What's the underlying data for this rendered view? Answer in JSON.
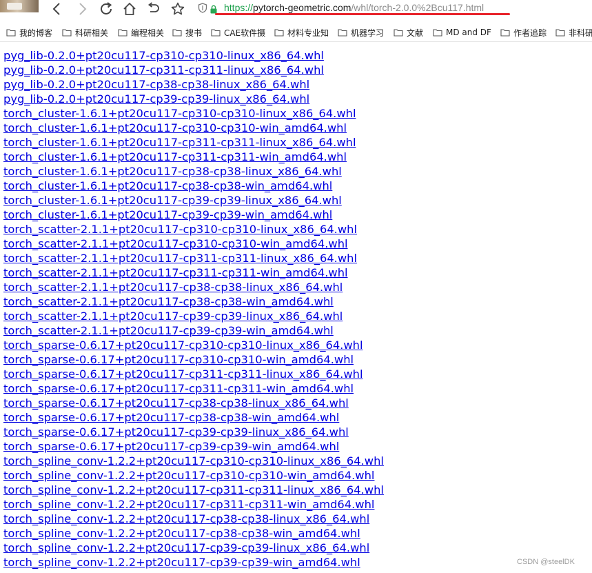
{
  "browser": {
    "url": {
      "scheme": "https://",
      "host": "pytorch-geometric.com",
      "path": "/whl/torch-2.0.0%2Bcu117.html"
    },
    "nav_icons": [
      "back-icon",
      "forward-icon",
      "reload-icon",
      "home-icon",
      "undo-icon",
      "favorite-star-icon"
    ]
  },
  "bookmarks": [
    {
      "label": "我的博客"
    },
    {
      "label": "科研相关"
    },
    {
      "label": "编程相关"
    },
    {
      "label": "搜书"
    },
    {
      "label": "CAE软件摄"
    },
    {
      "label": "材料专业知"
    },
    {
      "label": "机器学习"
    },
    {
      "label": "文献"
    },
    {
      "label": "MD and DF"
    },
    {
      "label": "作者追踪"
    },
    {
      "label": "非科研"
    }
  ],
  "links": [
    "pyg_lib-0.2.0+pt20cu117-cp310-cp310-linux_x86_64.whl",
    "pyg_lib-0.2.0+pt20cu117-cp311-cp311-linux_x86_64.whl",
    "pyg_lib-0.2.0+pt20cu117-cp38-cp38-linux_x86_64.whl",
    "pyg_lib-0.2.0+pt20cu117-cp39-cp39-linux_x86_64.whl",
    "torch_cluster-1.6.1+pt20cu117-cp310-cp310-linux_x86_64.whl",
    "torch_cluster-1.6.1+pt20cu117-cp310-cp310-win_amd64.whl",
    "torch_cluster-1.6.1+pt20cu117-cp311-cp311-linux_x86_64.whl",
    "torch_cluster-1.6.1+pt20cu117-cp311-cp311-win_amd64.whl",
    "torch_cluster-1.6.1+pt20cu117-cp38-cp38-linux_x86_64.whl",
    "torch_cluster-1.6.1+pt20cu117-cp38-cp38-win_amd64.whl",
    "torch_cluster-1.6.1+pt20cu117-cp39-cp39-linux_x86_64.whl",
    "torch_cluster-1.6.1+pt20cu117-cp39-cp39-win_amd64.whl",
    "torch_scatter-2.1.1+pt20cu117-cp310-cp310-linux_x86_64.whl",
    "torch_scatter-2.1.1+pt20cu117-cp310-cp310-win_amd64.whl",
    "torch_scatter-2.1.1+pt20cu117-cp311-cp311-linux_x86_64.whl",
    "torch_scatter-2.1.1+pt20cu117-cp311-cp311-win_amd64.whl",
    "torch_scatter-2.1.1+pt20cu117-cp38-cp38-linux_x86_64.whl",
    "torch_scatter-2.1.1+pt20cu117-cp38-cp38-win_amd64.whl",
    "torch_scatter-2.1.1+pt20cu117-cp39-cp39-linux_x86_64.whl",
    "torch_scatter-2.1.1+pt20cu117-cp39-cp39-win_amd64.whl",
    "torch_sparse-0.6.17+pt20cu117-cp310-cp310-linux_x86_64.whl",
    "torch_sparse-0.6.17+pt20cu117-cp310-cp310-win_amd64.whl",
    "torch_sparse-0.6.17+pt20cu117-cp311-cp311-linux_x86_64.whl",
    "torch_sparse-0.6.17+pt20cu117-cp311-cp311-win_amd64.whl",
    "torch_sparse-0.6.17+pt20cu117-cp38-cp38-linux_x86_64.whl",
    "torch_sparse-0.6.17+pt20cu117-cp38-cp38-win_amd64.whl",
    "torch_sparse-0.6.17+pt20cu117-cp39-cp39-linux_x86_64.whl",
    "torch_sparse-0.6.17+pt20cu117-cp39-cp39-win_amd64.whl",
    "torch_spline_conv-1.2.2+pt20cu117-cp310-cp310-linux_x86_64.whl",
    "torch_spline_conv-1.2.2+pt20cu117-cp310-cp310-win_amd64.whl",
    "torch_spline_conv-1.2.2+pt20cu117-cp311-cp311-linux_x86_64.whl",
    "torch_spline_conv-1.2.2+pt20cu117-cp311-cp311-win_amd64.whl",
    "torch_spline_conv-1.2.2+pt20cu117-cp38-cp38-linux_x86_64.whl",
    "torch_spline_conv-1.2.2+pt20cu117-cp38-cp38-win_amd64.whl",
    "torch_spline_conv-1.2.2+pt20cu117-cp39-cp39-linux_x86_64.whl",
    "torch_spline_conv-1.2.2+pt20cu117-cp39-cp39-win_amd64.whl"
  ],
  "watermark": "CSDN @steelDK",
  "colors": {
    "link": "#0000e0",
    "url_scheme": "#1a9f4a",
    "url_path": "#8a8a8a",
    "highlight_underline": "#e8222a"
  }
}
